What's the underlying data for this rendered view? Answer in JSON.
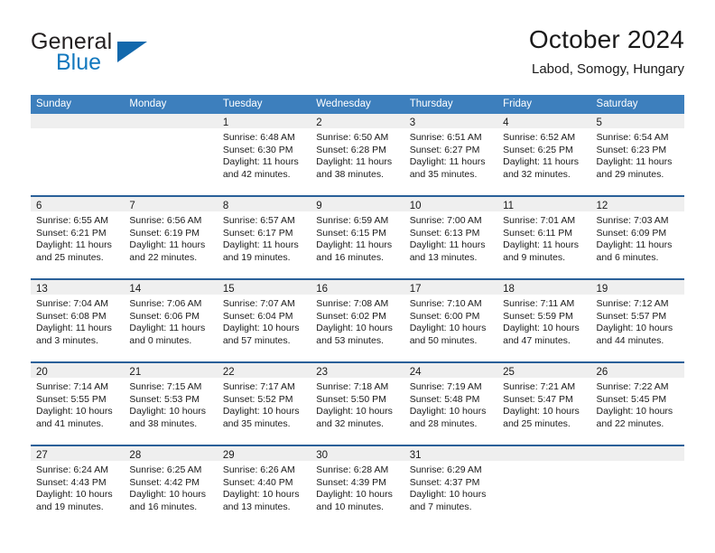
{
  "brand": {
    "name_top": "General",
    "name_bottom": "Blue",
    "triangle_color": "#1268ac",
    "blue_text_color": "#1278be"
  },
  "header": {
    "title": "October 2024",
    "subtitle": "Labod, Somogy, Hungary"
  },
  "theme": {
    "header_blue": "#3d7fbd",
    "row_border_blue": "#2a6099",
    "day_band_gray": "#efefef"
  },
  "weekdays": [
    "Sunday",
    "Monday",
    "Tuesday",
    "Wednesday",
    "Thursday",
    "Friday",
    "Saturday"
  ],
  "weeks": [
    [
      {
        "empty": true
      },
      {
        "empty": true
      },
      {
        "day": "1",
        "sunrise": "Sunrise: 6:48 AM",
        "sunset": "Sunset: 6:30 PM",
        "daylight1": "Daylight: 11 hours",
        "daylight2": "and 42 minutes."
      },
      {
        "day": "2",
        "sunrise": "Sunrise: 6:50 AM",
        "sunset": "Sunset: 6:28 PM",
        "daylight1": "Daylight: 11 hours",
        "daylight2": "and 38 minutes."
      },
      {
        "day": "3",
        "sunrise": "Sunrise: 6:51 AM",
        "sunset": "Sunset: 6:27 PM",
        "daylight1": "Daylight: 11 hours",
        "daylight2": "and 35 minutes."
      },
      {
        "day": "4",
        "sunrise": "Sunrise: 6:52 AM",
        "sunset": "Sunset: 6:25 PM",
        "daylight1": "Daylight: 11 hours",
        "daylight2": "and 32 minutes."
      },
      {
        "day": "5",
        "sunrise": "Sunrise: 6:54 AM",
        "sunset": "Sunset: 6:23 PM",
        "daylight1": "Daylight: 11 hours",
        "daylight2": "and 29 minutes."
      }
    ],
    [
      {
        "day": "6",
        "sunrise": "Sunrise: 6:55 AM",
        "sunset": "Sunset: 6:21 PM",
        "daylight1": "Daylight: 11 hours",
        "daylight2": "and 25 minutes."
      },
      {
        "day": "7",
        "sunrise": "Sunrise: 6:56 AM",
        "sunset": "Sunset: 6:19 PM",
        "daylight1": "Daylight: 11 hours",
        "daylight2": "and 22 minutes."
      },
      {
        "day": "8",
        "sunrise": "Sunrise: 6:57 AM",
        "sunset": "Sunset: 6:17 PM",
        "daylight1": "Daylight: 11 hours",
        "daylight2": "and 19 minutes."
      },
      {
        "day": "9",
        "sunrise": "Sunrise: 6:59 AM",
        "sunset": "Sunset: 6:15 PM",
        "daylight1": "Daylight: 11 hours",
        "daylight2": "and 16 minutes."
      },
      {
        "day": "10",
        "sunrise": "Sunrise: 7:00 AM",
        "sunset": "Sunset: 6:13 PM",
        "daylight1": "Daylight: 11 hours",
        "daylight2": "and 13 minutes."
      },
      {
        "day": "11",
        "sunrise": "Sunrise: 7:01 AM",
        "sunset": "Sunset: 6:11 PM",
        "daylight1": "Daylight: 11 hours",
        "daylight2": "and 9 minutes."
      },
      {
        "day": "12",
        "sunrise": "Sunrise: 7:03 AM",
        "sunset": "Sunset: 6:09 PM",
        "daylight1": "Daylight: 11 hours",
        "daylight2": "and 6 minutes."
      }
    ],
    [
      {
        "day": "13",
        "sunrise": "Sunrise: 7:04 AM",
        "sunset": "Sunset: 6:08 PM",
        "daylight1": "Daylight: 11 hours",
        "daylight2": "and 3 minutes."
      },
      {
        "day": "14",
        "sunrise": "Sunrise: 7:06 AM",
        "sunset": "Sunset: 6:06 PM",
        "daylight1": "Daylight: 11 hours",
        "daylight2": "and 0 minutes."
      },
      {
        "day": "15",
        "sunrise": "Sunrise: 7:07 AM",
        "sunset": "Sunset: 6:04 PM",
        "daylight1": "Daylight: 10 hours",
        "daylight2": "and 57 minutes."
      },
      {
        "day": "16",
        "sunrise": "Sunrise: 7:08 AM",
        "sunset": "Sunset: 6:02 PM",
        "daylight1": "Daylight: 10 hours",
        "daylight2": "and 53 minutes."
      },
      {
        "day": "17",
        "sunrise": "Sunrise: 7:10 AM",
        "sunset": "Sunset: 6:00 PM",
        "daylight1": "Daylight: 10 hours",
        "daylight2": "and 50 minutes."
      },
      {
        "day": "18",
        "sunrise": "Sunrise: 7:11 AM",
        "sunset": "Sunset: 5:59 PM",
        "daylight1": "Daylight: 10 hours",
        "daylight2": "and 47 minutes."
      },
      {
        "day": "19",
        "sunrise": "Sunrise: 7:12 AM",
        "sunset": "Sunset: 5:57 PM",
        "daylight1": "Daylight: 10 hours",
        "daylight2": "and 44 minutes."
      }
    ],
    [
      {
        "day": "20",
        "sunrise": "Sunrise: 7:14 AM",
        "sunset": "Sunset: 5:55 PM",
        "daylight1": "Daylight: 10 hours",
        "daylight2": "and 41 minutes."
      },
      {
        "day": "21",
        "sunrise": "Sunrise: 7:15 AM",
        "sunset": "Sunset: 5:53 PM",
        "daylight1": "Daylight: 10 hours",
        "daylight2": "and 38 minutes."
      },
      {
        "day": "22",
        "sunrise": "Sunrise: 7:17 AM",
        "sunset": "Sunset: 5:52 PM",
        "daylight1": "Daylight: 10 hours",
        "daylight2": "and 35 minutes."
      },
      {
        "day": "23",
        "sunrise": "Sunrise: 7:18 AM",
        "sunset": "Sunset: 5:50 PM",
        "daylight1": "Daylight: 10 hours",
        "daylight2": "and 32 minutes."
      },
      {
        "day": "24",
        "sunrise": "Sunrise: 7:19 AM",
        "sunset": "Sunset: 5:48 PM",
        "daylight1": "Daylight: 10 hours",
        "daylight2": "and 28 minutes."
      },
      {
        "day": "25",
        "sunrise": "Sunrise: 7:21 AM",
        "sunset": "Sunset: 5:47 PM",
        "daylight1": "Daylight: 10 hours",
        "daylight2": "and 25 minutes."
      },
      {
        "day": "26",
        "sunrise": "Sunrise: 7:22 AM",
        "sunset": "Sunset: 5:45 PM",
        "daylight1": "Daylight: 10 hours",
        "daylight2": "and 22 minutes."
      }
    ],
    [
      {
        "day": "27",
        "sunrise": "Sunrise: 6:24 AM",
        "sunset": "Sunset: 4:43 PM",
        "daylight1": "Daylight: 10 hours",
        "daylight2": "and 19 minutes."
      },
      {
        "day": "28",
        "sunrise": "Sunrise: 6:25 AM",
        "sunset": "Sunset: 4:42 PM",
        "daylight1": "Daylight: 10 hours",
        "daylight2": "and 16 minutes."
      },
      {
        "day": "29",
        "sunrise": "Sunrise: 6:26 AM",
        "sunset": "Sunset: 4:40 PM",
        "daylight1": "Daylight: 10 hours",
        "daylight2": "and 13 minutes."
      },
      {
        "day": "30",
        "sunrise": "Sunrise: 6:28 AM",
        "sunset": "Sunset: 4:39 PM",
        "daylight1": "Daylight: 10 hours",
        "daylight2": "and 10 minutes."
      },
      {
        "day": "31",
        "sunrise": "Sunrise: 6:29 AM",
        "sunset": "Sunset: 4:37 PM",
        "daylight1": "Daylight: 10 hours",
        "daylight2": "and 7 minutes."
      },
      {
        "empty": true
      },
      {
        "empty": true
      }
    ]
  ]
}
